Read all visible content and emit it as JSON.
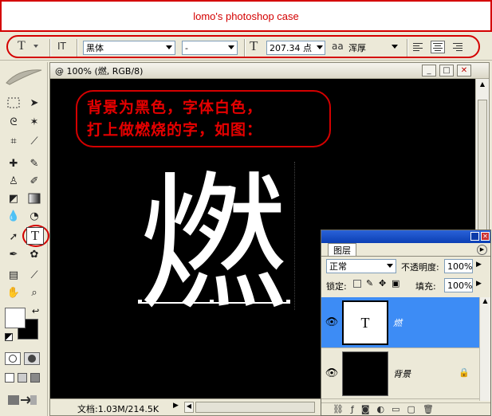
{
  "banner": {
    "title": "lomo's photoshop case"
  },
  "options_bar": {
    "tool_icon": "T",
    "orient_icon": "IT",
    "font_family": "黑体",
    "font_style": "-",
    "size_icon": "T",
    "font_size": "207.34 点",
    "aa_icon": "aa",
    "antialias": "浑厚"
  },
  "toolbox": {
    "tools": [
      "marquee",
      "move",
      "lasso",
      "magic-wand",
      "crop",
      "slice",
      "healing",
      "brush",
      "stamp",
      "history-brush",
      "eraser",
      "gradient",
      "blur",
      "dodge",
      "path-select",
      "type",
      "pen",
      "shape",
      "notes",
      "eyedropper",
      "hand",
      "zoom"
    ],
    "type_tool_label": "T"
  },
  "document": {
    "title": "@ 100% (燃, RGB/8)",
    "annotation_line1": "背景为黑色，字体白色，",
    "annotation_line2": "打上做燃烧的字，如图：",
    "glyph": "燃",
    "status": "文档:1.03M/214.5K"
  },
  "layers_panel": {
    "tab": "图层",
    "blend_mode": "正常",
    "opacity_label": "不透明度:",
    "opacity": "100%",
    "lock_label": "锁定:",
    "fill_label": "填充:",
    "fill": "100%",
    "layers": [
      {
        "name": "燃",
        "thumb_label": "T",
        "selected": true
      },
      {
        "name": "背景",
        "thumb_label": "",
        "selected": false
      }
    ]
  },
  "colors": {
    "annotation_red": "#d40000",
    "selection_blue": "#3d8cf5",
    "title_blue": "#0b3fb4"
  }
}
